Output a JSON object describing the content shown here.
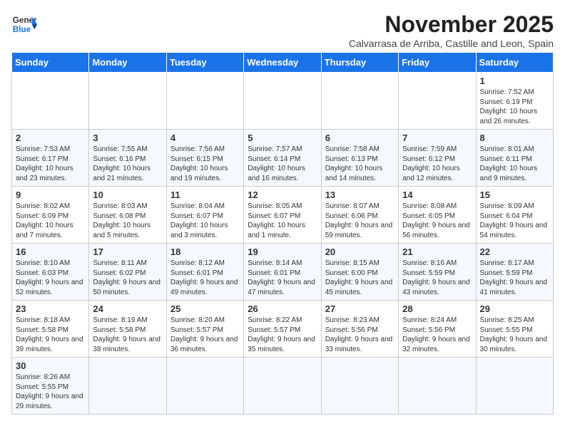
{
  "header": {
    "logo_general": "General",
    "logo_blue": "Blue",
    "title": "November 2025",
    "subtitle": "Calvarrasa de Arriba, Castille and Leon, Spain"
  },
  "columns": [
    "Sunday",
    "Monday",
    "Tuesday",
    "Wednesday",
    "Thursday",
    "Friday",
    "Saturday"
  ],
  "weeks": [
    [
      {
        "day": "",
        "info": ""
      },
      {
        "day": "",
        "info": ""
      },
      {
        "day": "",
        "info": ""
      },
      {
        "day": "",
        "info": ""
      },
      {
        "day": "",
        "info": ""
      },
      {
        "day": "",
        "info": ""
      },
      {
        "day": "1",
        "info": "Sunrise: 7:52 AM\nSunset: 6:19 PM\nDaylight: 10 hours and 26 minutes."
      }
    ],
    [
      {
        "day": "2",
        "info": "Sunrise: 7:53 AM\nSunset: 6:17 PM\nDaylight: 10 hours and 23 minutes."
      },
      {
        "day": "3",
        "info": "Sunrise: 7:55 AM\nSunset: 6:16 PM\nDaylight: 10 hours and 21 minutes."
      },
      {
        "day": "4",
        "info": "Sunrise: 7:56 AM\nSunset: 6:15 PM\nDaylight: 10 hours and 19 minutes."
      },
      {
        "day": "5",
        "info": "Sunrise: 7:57 AM\nSunset: 6:14 PM\nDaylight: 10 hours and 16 minutes."
      },
      {
        "day": "6",
        "info": "Sunrise: 7:58 AM\nSunset: 6:13 PM\nDaylight: 10 hours and 14 minutes."
      },
      {
        "day": "7",
        "info": "Sunrise: 7:59 AM\nSunset: 6:12 PM\nDaylight: 10 hours and 12 minutes."
      },
      {
        "day": "8",
        "info": "Sunrise: 8:01 AM\nSunset: 6:11 PM\nDaylight: 10 hours and 9 minutes."
      }
    ],
    [
      {
        "day": "9",
        "info": "Sunrise: 8:02 AM\nSunset: 6:09 PM\nDaylight: 10 hours and 7 minutes."
      },
      {
        "day": "10",
        "info": "Sunrise: 8:03 AM\nSunset: 6:08 PM\nDaylight: 10 hours and 5 minutes."
      },
      {
        "day": "11",
        "info": "Sunrise: 8:04 AM\nSunset: 6:07 PM\nDaylight: 10 hours and 3 minutes."
      },
      {
        "day": "12",
        "info": "Sunrise: 8:05 AM\nSunset: 6:07 PM\nDaylight: 10 hours and 1 minute."
      },
      {
        "day": "13",
        "info": "Sunrise: 8:07 AM\nSunset: 6:06 PM\nDaylight: 9 hours and 59 minutes."
      },
      {
        "day": "14",
        "info": "Sunrise: 8:08 AM\nSunset: 6:05 PM\nDaylight: 9 hours and 56 minutes."
      },
      {
        "day": "15",
        "info": "Sunrise: 8:09 AM\nSunset: 6:04 PM\nDaylight: 9 hours and 54 minutes."
      }
    ],
    [
      {
        "day": "16",
        "info": "Sunrise: 8:10 AM\nSunset: 6:03 PM\nDaylight: 9 hours and 52 minutes."
      },
      {
        "day": "17",
        "info": "Sunrise: 8:11 AM\nSunset: 6:02 PM\nDaylight: 9 hours and 50 minutes."
      },
      {
        "day": "18",
        "info": "Sunrise: 8:12 AM\nSunset: 6:01 PM\nDaylight: 9 hours and 49 minutes."
      },
      {
        "day": "19",
        "info": "Sunrise: 8:14 AM\nSunset: 6:01 PM\nDaylight: 9 hours and 47 minutes."
      },
      {
        "day": "20",
        "info": "Sunrise: 8:15 AM\nSunset: 6:00 PM\nDaylight: 9 hours and 45 minutes."
      },
      {
        "day": "21",
        "info": "Sunrise: 8:16 AM\nSunset: 5:59 PM\nDaylight: 9 hours and 43 minutes."
      },
      {
        "day": "22",
        "info": "Sunrise: 8:17 AM\nSunset: 5:59 PM\nDaylight: 9 hours and 41 minutes."
      }
    ],
    [
      {
        "day": "23",
        "info": "Sunrise: 8:18 AM\nSunset: 5:58 PM\nDaylight: 9 hours and 39 minutes."
      },
      {
        "day": "24",
        "info": "Sunrise: 8:19 AM\nSunset: 5:58 PM\nDaylight: 9 hours and 38 minutes."
      },
      {
        "day": "25",
        "info": "Sunrise: 8:20 AM\nSunset: 5:57 PM\nDaylight: 9 hours and 36 minutes."
      },
      {
        "day": "26",
        "info": "Sunrise: 8:22 AM\nSunset: 5:57 PM\nDaylight: 9 hours and 35 minutes."
      },
      {
        "day": "27",
        "info": "Sunrise: 8:23 AM\nSunset: 5:56 PM\nDaylight: 9 hours and 33 minutes."
      },
      {
        "day": "28",
        "info": "Sunrise: 8:24 AM\nSunset: 5:56 PM\nDaylight: 9 hours and 32 minutes."
      },
      {
        "day": "29",
        "info": "Sunrise: 8:25 AM\nSunset: 5:55 PM\nDaylight: 9 hours and 30 minutes."
      }
    ],
    [
      {
        "day": "30",
        "info": "Sunrise: 8:26 AM\nSunset: 5:55 PM\nDaylight: 9 hours and 29 minutes."
      },
      {
        "day": "",
        "info": ""
      },
      {
        "day": "",
        "info": ""
      },
      {
        "day": "",
        "info": ""
      },
      {
        "day": "",
        "info": ""
      },
      {
        "day": "",
        "info": ""
      },
      {
        "day": "",
        "info": ""
      }
    ]
  ]
}
